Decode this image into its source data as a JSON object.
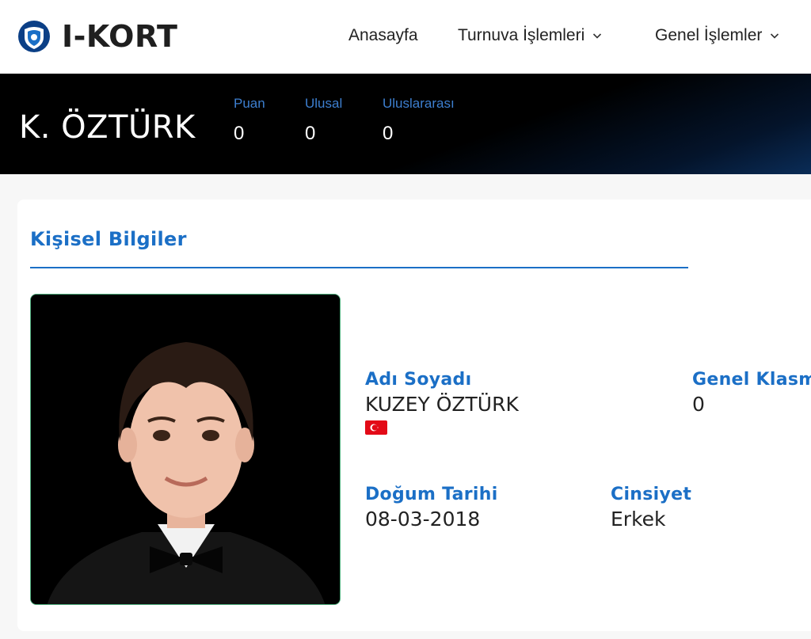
{
  "brand": {
    "name": "I-KORT",
    "logo_icon": "ikort-shield-icon",
    "accent": "#1b6fc6"
  },
  "nav": {
    "items": [
      {
        "label": "Anasayfa",
        "has_dropdown": false
      },
      {
        "label": "Turnuva İşlemleri",
        "has_dropdown": true
      },
      {
        "label": "Genel İşlemler",
        "has_dropdown": true
      }
    ]
  },
  "hero": {
    "name": "K. ÖZTÜRK",
    "stats": [
      {
        "label": "Puan",
        "value": "0"
      },
      {
        "label": "Ulusal",
        "value": "0"
      },
      {
        "label": "Uluslararası",
        "value": "0"
      }
    ]
  },
  "profile": {
    "section_title": "Kişisel Bilgiler",
    "photo_icon": "player-photo",
    "full_name_label": "Adı Soyadı",
    "full_name": "KUZEY ÖZTÜRK",
    "nationality_flag": "turkey-flag-icon",
    "general_rank_label": "Genel Klasman",
    "general_rank": "0",
    "birth_date_label": "Doğum Tarihi",
    "birth_date": "08-03-2018",
    "gender_label": "Cinsiyet",
    "gender": "Erkek"
  }
}
